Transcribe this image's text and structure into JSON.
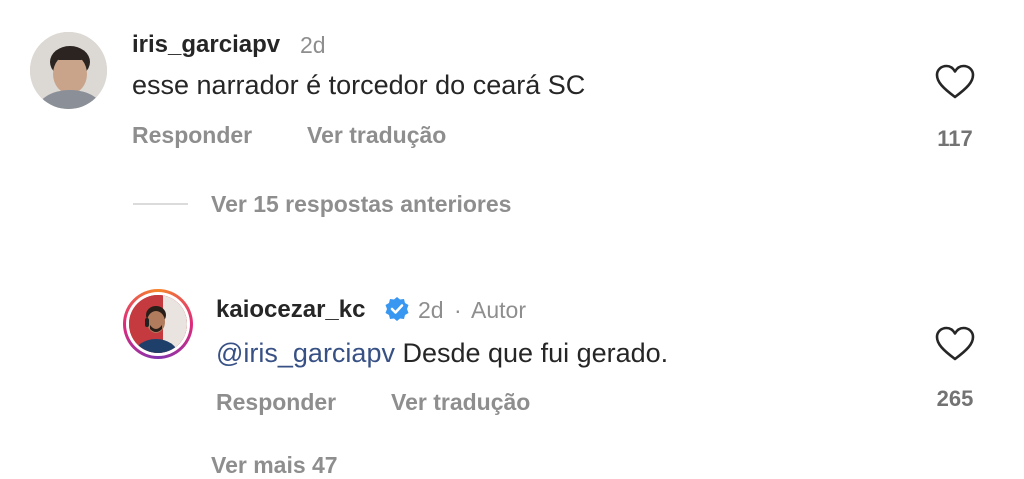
{
  "comment1": {
    "username": "iris_garciapv",
    "time": "2d",
    "text": "esse narrador é torcedor do ceará SC",
    "reply_label": "Responder",
    "translate_label": "Ver tradução",
    "like_count": "117"
  },
  "view_previous_replies": "Ver 15 respostas anteriores",
  "reply1": {
    "username": "kaiocezar_kc",
    "time": "2d",
    "separator": "·",
    "author_badge": "Autor",
    "mention": "@iris_garciapv",
    "text": " Desde que fui gerado.",
    "reply_label": "Responder",
    "translate_label": "Ver tradução",
    "like_count": "265"
  },
  "next_partial_text": "Ver mais 47",
  "colors": {
    "mention": "#385185",
    "verified": "#3897f0",
    "secondary_text": "#8e8e8e"
  }
}
